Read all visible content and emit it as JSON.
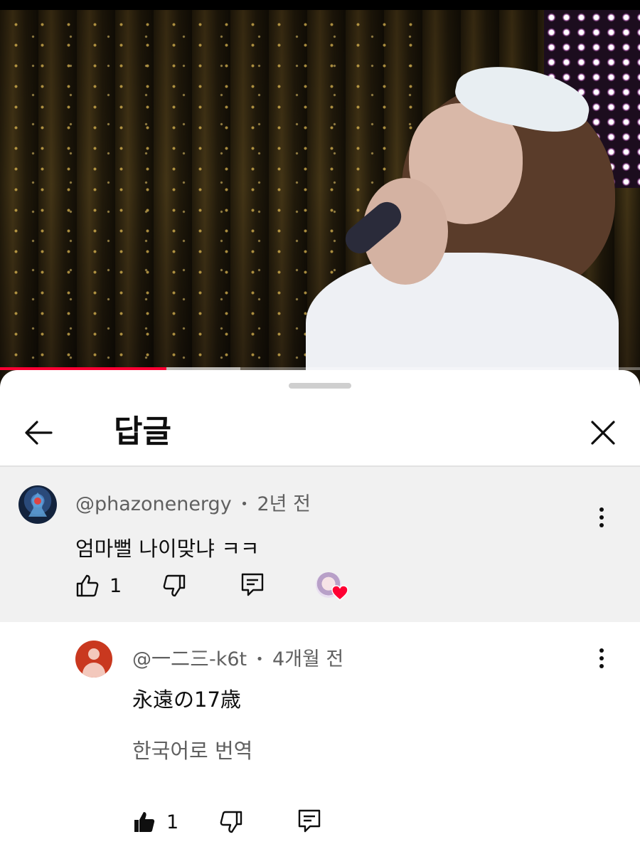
{
  "video": {
    "progress_fraction": 0.26,
    "buffer_fraction": 0.375
  },
  "sheet": {
    "title": "답글"
  },
  "parent_comment": {
    "author": "@phazonenergy",
    "separator": "•",
    "time": "2년 전",
    "text": "엄마뻘 나이맞냐 ㅋㅋ",
    "like_count": "1"
  },
  "reply": {
    "author": "@一二三-k6t",
    "separator": "•",
    "time": "4개월 전",
    "text": "永遠の17歳",
    "translate_label": "한국어로 번역",
    "like_count": "1"
  },
  "colors": {
    "progress": "#ff0033",
    "heart": "#ff0033",
    "parent_bg": "#f1f1f1",
    "reply_avatar": "#c9381f"
  },
  "icons": {
    "back": "arrow-left-icon",
    "close": "close-icon",
    "more": "more-vertical-icon",
    "like": "thumb-up-icon",
    "dislike": "thumb-down-icon",
    "reply": "comment-icon",
    "creator_heart": "heart-icon"
  }
}
